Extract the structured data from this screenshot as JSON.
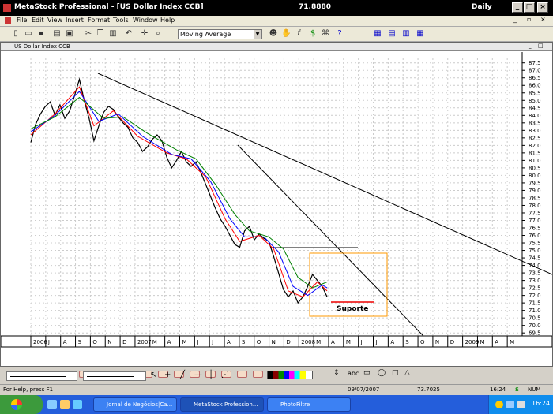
{
  "window": {
    "title": "MetaStock Professional - [US Dollar Index CCB]",
    "last_price": "71.8880",
    "period": "Daily"
  },
  "menu": [
    "File",
    "Edit",
    "View",
    "Insert",
    "Format",
    "Tools",
    "Window",
    "Help"
  ],
  "toolbar": {
    "indicator_select": "Moving Average"
  },
  "chart": {
    "title": "US Dollar Index CCB",
    "annotation": "Suporte"
  },
  "chart_data": {
    "type": "line",
    "title": "US Dollar Index CCB",
    "y_ticks": [
      "87.5",
      "87.0",
      "86.5",
      "86.0",
      "85.5",
      "85.0",
      "84.5",
      "84.0",
      "83.5",
      "83.0",
      "82.5",
      "82.0",
      "81.5",
      "81.0",
      "80.5",
      "80.0",
      "79.5",
      "79.0",
      "78.5",
      "78.0",
      "77.5",
      "77.0",
      "76.5",
      "76.0",
      "75.5",
      "75.0",
      "74.5",
      "74.0",
      "73.5",
      "73.0",
      "72.5",
      "72.0",
      "71.5",
      "71.0",
      "70.5",
      "70.0",
      "69.5"
    ],
    "ylim": [
      69.3,
      87.8
    ],
    "x_ticks": [
      "2006",
      "J",
      "A",
      "S",
      "O",
      "N",
      "D",
      "2007",
      "M",
      "A",
      "M",
      "J",
      "J",
      "A",
      "S",
      "O",
      "N",
      "D",
      "2008",
      "M",
      "A",
      "M",
      "J",
      "J",
      "A",
      "S",
      "O",
      "N",
      "D",
      "2009",
      "M",
      "A",
      "M"
    ],
    "x_month_index_range": [
      0,
      40
    ],
    "series": [
      {
        "name": "",
        "color": "#000000",
        "values": [
          [
            0,
            82.2
          ],
          [
            1,
            83.4
          ],
          [
            2,
            84.1
          ],
          [
            3,
            84.6
          ],
          [
            4,
            84.9
          ],
          [
            5,
            84.0
          ],
          [
            6,
            84.7
          ],
          [
            7,
            83.8
          ],
          [
            8,
            84.3
          ],
          [
            9,
            85.3
          ],
          [
            10,
            86.4
          ],
          [
            11,
            85.0
          ],
          [
            12,
            83.8
          ],
          [
            13,
            82.3
          ],
          [
            14,
            83.3
          ],
          [
            15,
            84.2
          ],
          [
            16,
            84.6
          ],
          [
            17,
            84.4
          ],
          [
            18,
            83.9
          ],
          [
            19,
            83.5
          ],
          [
            20,
            83.2
          ],
          [
            21,
            82.5
          ],
          [
            22,
            82.2
          ],
          [
            23,
            81.6
          ],
          [
            24,
            81.9
          ],
          [
            25,
            82.4
          ],
          [
            26,
            82.7
          ],
          [
            27,
            82.3
          ],
          [
            28,
            81.2
          ],
          [
            29,
            80.5
          ],
          [
            30,
            81.0
          ],
          [
            31,
            81.6
          ],
          [
            32,
            80.9
          ],
          [
            33,
            80.6
          ],
          [
            34,
            80.9
          ],
          [
            35,
            80.2
          ],
          [
            36,
            79.4
          ],
          [
            37,
            78.6
          ],
          [
            38,
            77.8
          ],
          [
            39,
            77.1
          ],
          [
            40,
            76.6
          ],
          [
            41,
            76.0
          ],
          [
            42,
            75.4
          ],
          [
            43,
            75.2
          ],
          [
            44,
            76.3
          ],
          [
            45,
            76.6
          ],
          [
            46,
            75.7
          ],
          [
            47,
            76.1
          ],
          [
            48,
            75.8
          ],
          [
            49,
            75.6
          ],
          [
            50,
            74.6
          ],
          [
            51,
            73.5
          ],
          [
            52,
            72.4
          ],
          [
            53,
            71.9
          ],
          [
            54,
            72.3
          ],
          [
            55,
            71.5
          ],
          [
            56,
            71.9
          ],
          [
            57,
            72.6
          ],
          [
            58,
            73.4
          ],
          [
            59,
            73.0
          ],
          [
            60,
            72.6
          ],
          [
            61,
            71.9
          ]
        ]
      },
      {
        "name": "",
        "color": "#ff0000",
        "values": [
          [
            0,
            82.7
          ],
          [
            5,
            84.1
          ],
          [
            10,
            85.9
          ],
          [
            13,
            83.3
          ],
          [
            17,
            84.3
          ],
          [
            22,
            82.6
          ],
          [
            28,
            81.5
          ],
          [
            32,
            81.1
          ],
          [
            36,
            79.9
          ],
          [
            40,
            77.1
          ],
          [
            43,
            75.6
          ],
          [
            47,
            76.0
          ],
          [
            50,
            75.1
          ],
          [
            53,
            72.3
          ],
          [
            56,
            71.9
          ],
          [
            59,
            72.9
          ],
          [
            61,
            72.3
          ]
        ]
      },
      {
        "name": "",
        "color": "#0000ff",
        "values": [
          [
            0,
            82.9
          ],
          [
            5,
            84.0
          ],
          [
            10,
            85.6
          ],
          [
            14,
            83.6
          ],
          [
            18,
            84.1
          ],
          [
            23,
            82.6
          ],
          [
            29,
            81.4
          ],
          [
            33,
            81.1
          ],
          [
            37,
            79.6
          ],
          [
            41,
            77.1
          ],
          [
            44,
            75.9
          ],
          [
            48,
            75.9
          ],
          [
            51,
            74.9
          ],
          [
            54,
            72.6
          ],
          [
            57,
            72.0
          ],
          [
            60,
            72.7
          ],
          [
            61,
            72.5
          ]
        ]
      },
      {
        "name": "",
        "color": "#008000",
        "values": [
          [
            0,
            83.1
          ],
          [
            5,
            83.9
          ],
          [
            10,
            85.2
          ],
          [
            15,
            83.8
          ],
          [
            19,
            83.9
          ],
          [
            24,
            82.8
          ],
          [
            30,
            81.7
          ],
          [
            34,
            81.1
          ],
          [
            38,
            79.4
          ],
          [
            42,
            77.4
          ],
          [
            45,
            76.3
          ],
          [
            49,
            75.9
          ],
          [
            52,
            75.1
          ],
          [
            55,
            73.2
          ],
          [
            58,
            72.5
          ],
          [
            61,
            72.9
          ]
        ]
      }
    ]
  },
  "drawbar": {
    "text_tool": "abc"
  },
  "status": {
    "help": "For Help, press F1",
    "date": "09/07/2007",
    "value": "73.7025",
    "time": "16:24",
    "caps": "$",
    "num": "NUM"
  },
  "taskbar": {
    "start": "start",
    "tasks": [
      "Jornal de Negócios|Ca...",
      "MetaStock Profession...",
      "PhotoFiltre"
    ],
    "clock": "16:24"
  }
}
